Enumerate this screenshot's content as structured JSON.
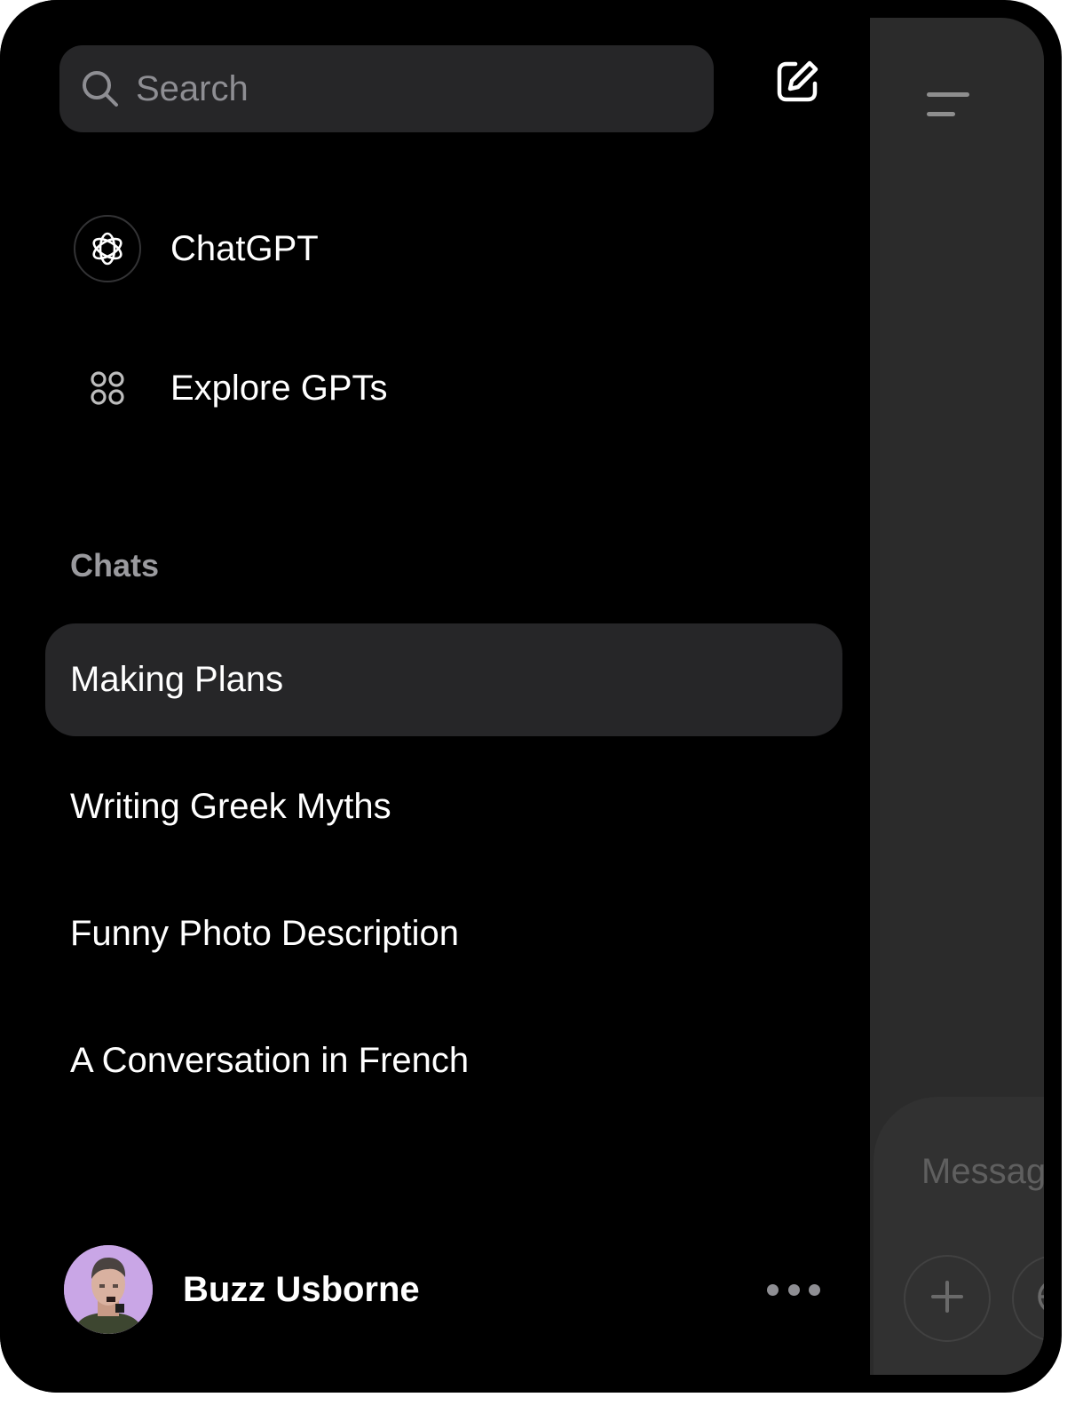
{
  "sidebar": {
    "search": {
      "placeholder": "Search",
      "value": ""
    },
    "new_chat_icon": "compose-icon",
    "nav": [
      {
        "label": "ChatGPT",
        "icon": "chatgpt-logo-icon"
      },
      {
        "label": "Explore GPTs",
        "icon": "apps-grid-icon"
      }
    ],
    "chats_section": {
      "title": "Chats",
      "items": [
        {
          "label": "Making Plans",
          "active": true
        },
        {
          "label": "Writing Greek Myths",
          "active": false
        },
        {
          "label": "Funny Photo Description",
          "active": false
        },
        {
          "label": "A Conversation in French",
          "active": false
        }
      ]
    },
    "user": {
      "name": "Buzz Usborne",
      "avatar_icon": "user-avatar",
      "more_icon": "more-horizontal-icon"
    }
  },
  "main": {
    "menu_icon": "hamburger-menu-icon",
    "composer": {
      "placeholder": "Message",
      "value": "",
      "attach_icon": "plus-icon",
      "globe_icon": "globe-icon"
    }
  },
  "colors": {
    "background": "#000000",
    "surface": "#262628",
    "text_primary": "#ffffff",
    "text_secondary": "#9a9a9e",
    "main_panel": "#2b2b2b",
    "avatar_bg": "#c9a6e6"
  }
}
